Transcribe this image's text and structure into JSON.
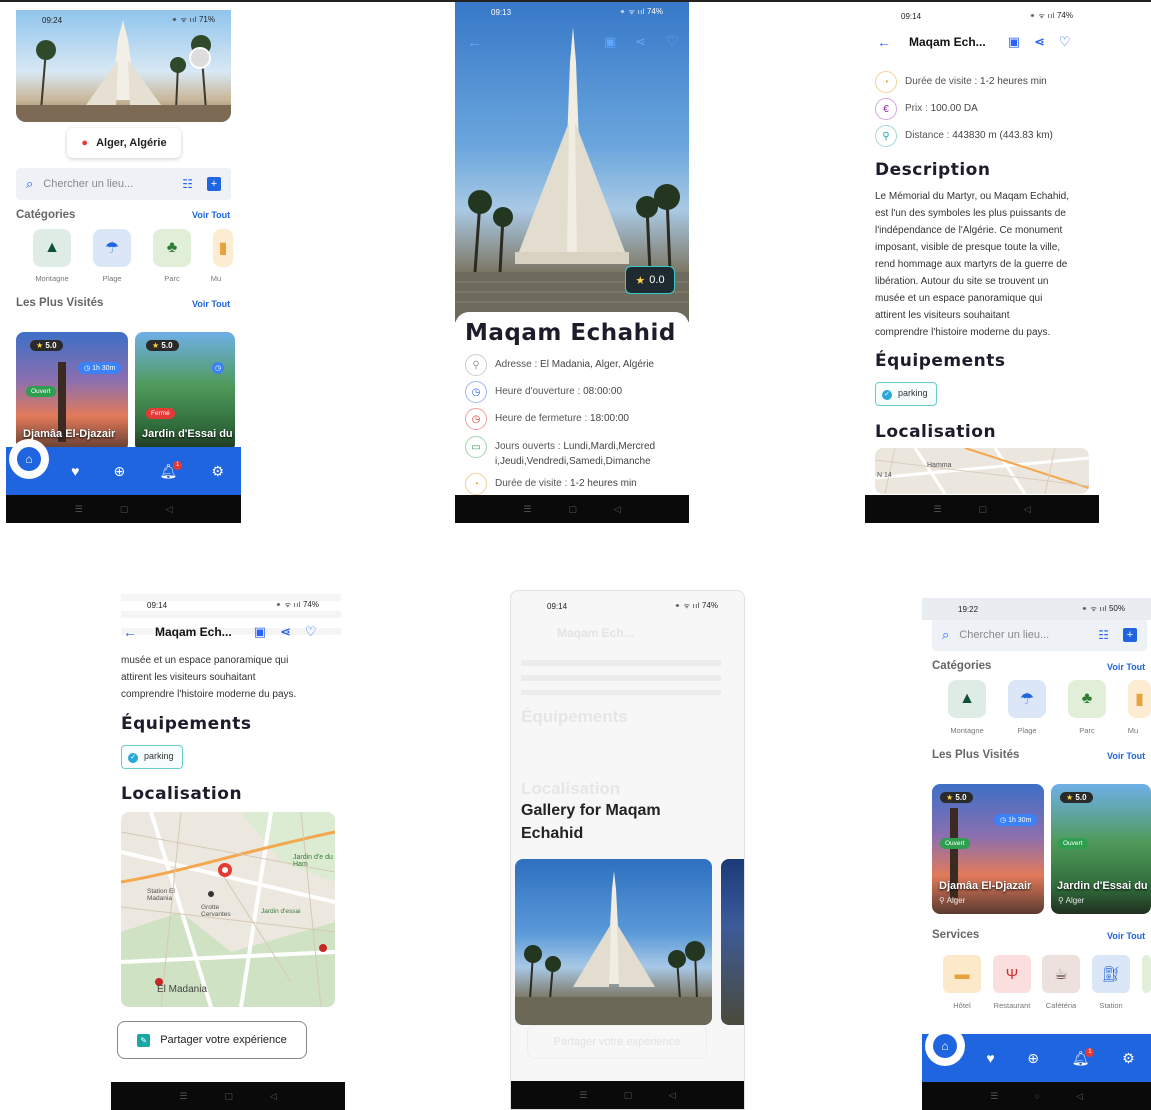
{
  "screens": {
    "home1": {
      "status_time": "09:24",
      "status_battery": "71%",
      "status_icons": "⚭ ᯤ ııl",
      "location": "Alger, Algérie",
      "search_placeholder": "Chercher un lieu...",
      "categories_title": "Catégories",
      "categories_see_all": "Voir Tout",
      "categories": [
        "Montagne",
        "Plage",
        "Parc",
        "Mu"
      ],
      "most_visited_title": "Les Plus Visités",
      "most_visited_see_all": "Voir Tout",
      "cards": [
        {
          "name": "Djamâa El-Djazair",
          "rating": "5.0",
          "duration": "1h 30m",
          "status": "Ouvert"
        },
        {
          "name": "Jardin d'Essai du",
          "rating": "5.0",
          "status": "Fermé"
        }
      ],
      "notif_count": "1"
    },
    "detail1": {
      "status_time": "09:13",
      "status_battery": "74%",
      "status_icons": "⚭ ᯤ ııl",
      "rating": "0.0",
      "title": "Maqam Echahid",
      "rows": [
        {
          "label": "Adresse :",
          "value": "El Madania, Alger, Algérie"
        },
        {
          "label": "Heure d'ouverture :",
          "value": "08:00:00"
        },
        {
          "label": "Heure de fermeture :",
          "value": "18:00:00"
        },
        {
          "label": "Jours ouverts :",
          "value": "Lundi,Mardi,Mercred",
          "value2": "i,Jeudi,Vendredi,Samedi,Dimanche"
        },
        {
          "label": "Durée de visite :",
          "value": "1-2 heures min"
        }
      ]
    },
    "detail2": {
      "status_time": "09:14",
      "status_battery": "74%",
      "status_icons": "⚭ ᯤ ııl",
      "header_title": "Maqam Ech...",
      "rows": [
        {
          "label": "Durée de visite :",
          "value": "1-2 heures min"
        },
        {
          "label": "Prix :",
          "value": "100.00 DA"
        },
        {
          "label": "Distance :",
          "value": "443830 m (443.83 km)"
        }
      ],
      "desc_title": "Description",
      "desc_lines": [
        "Le Mémorial du Martyr, ou Maqam Echahid,",
        "est l'un des symboles les plus puissants de",
        "l'indépendance de l'Algérie. Ce monument",
        "imposant, visible de presque toute la ville,",
        "rend hommage aux martyrs de la guerre de",
        "libération. Autour du site se trouvent un",
        "musée et un espace panoramique qui",
        "attirent les visiteurs souhaitant",
        "comprendre l'histoire moderne du pays."
      ],
      "equip_title": "Équipements",
      "equip_chip": "parking",
      "loc_title": "Localisation",
      "map_label_1": "Hamma",
      "map_label_2": "N 14"
    },
    "detail3": {
      "status_time": "09:14",
      "status_battery": "74%",
      "status_icons": "⚭ ᯤ ııl",
      "header_title": "Maqam Ech...",
      "desc_lines": [
        "musée et un espace panoramique qui",
        "attirent les visiteurs souhaitant",
        "comprendre l'histoire moderne du pays."
      ],
      "equip_title": "Équipements",
      "equip_chip": "parking",
      "loc_title": "Localisation",
      "map_labels": [
        "El Madania",
        "Jardin d'e du Ham",
        "Station El Madania",
        "Grotte Cervantes",
        "Jardin d'essai"
      ],
      "share_button": "Partager votre expérience"
    },
    "gallery": {
      "status_time": "09:14",
      "status_battery": "74%",
      "status_icons": "⚭ ᯤ ııl",
      "faded_header": "Maqam Ech...",
      "faded_equip": "Équipements",
      "faded_loc": "Localisation",
      "faded_share": "Partager votre expérience",
      "title_line1": "Gallery for Maqam",
      "title_line2": "Echahid"
    },
    "home2": {
      "status_time": "19:22",
      "status_battery": "50%",
      "status_icons": "⚭ ᯤ ııl",
      "search_placeholder": "Chercher un lieu...",
      "categories_title": "Catégories",
      "categories_see_all": "Voir Tout",
      "categories": [
        "Montagne",
        "Plage",
        "Parc",
        "Mu"
      ],
      "most_visited_title": "Les Plus Visités",
      "most_visited_see_all": "Voir Tout",
      "cards": [
        {
          "name": "Djamâa El-Djazair",
          "location": "Alger",
          "rating": "5.0",
          "duration": "1h 30m",
          "status": "Ouvert"
        },
        {
          "name": "Jardin d'Essai du",
          "location": "Alger",
          "rating": "5.0",
          "status": "Ouvert"
        }
      ],
      "services_title": "Services",
      "services_see_all": "Voir Tout",
      "services": [
        "Hôtel",
        "Restaurant",
        "Cafétéria",
        "Station"
      ],
      "notif_count": "1"
    }
  },
  "colors": {
    "primary": "#1f65e0",
    "accent_blue": "#2962ff",
    "open": "#2e9e4f",
    "closed": "#e53935",
    "rating_star": "#ffd54a"
  }
}
